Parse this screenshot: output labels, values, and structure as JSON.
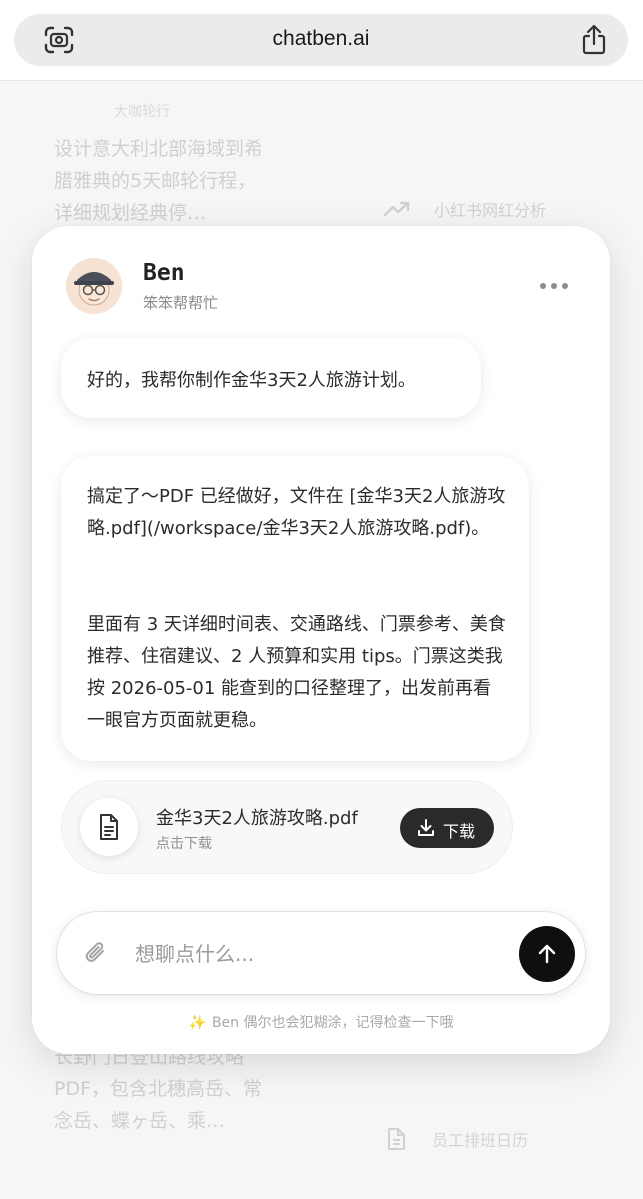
{
  "browser": {
    "url": "chatben.ai"
  },
  "background": {
    "tag": "大咖轮行",
    "card1_text": "设计意大利北部海域到希腊雅典的5天邮轮行程，详细规划经典停…",
    "trend_label": "小红书网红分析",
    "card2_text": "长野门日登山路线攻略PDF，包含北穗高岳、常念岳、蝶ヶ岳、乘…",
    "schedule_label": "员工排班日历"
  },
  "chat": {
    "bot_name": "Ben",
    "bot_subtitle": "笨笨帮帮忙",
    "messages": [
      {
        "paragraphs": [
          "好的，我帮你制作金华3天2人旅游计划。"
        ]
      },
      {
        "paragraphs": [
          "搞定了～PDF 已经做好，文件在 [金华3天2人旅游攻略.pdf](/workspace/金华3天2人旅游攻略.pdf)。",
          "里面有 3 天详细时间表、交通路线、门票参考、美食推荐、住宿建议、2 人预算和实用 tips。门票这类我按 2026-05-01 能查到的口径整理了，出发前再看一眼官方页面就更稳。"
        ]
      }
    ],
    "file": {
      "name": "金华3天2人旅游攻略.pdf",
      "hint": "点击下载",
      "download_label": "下载"
    },
    "input": {
      "placeholder": "想聊点什么..."
    },
    "disclaimer": "Ben 偶尔也会犯糊涂，记得检查一下哦"
  }
}
